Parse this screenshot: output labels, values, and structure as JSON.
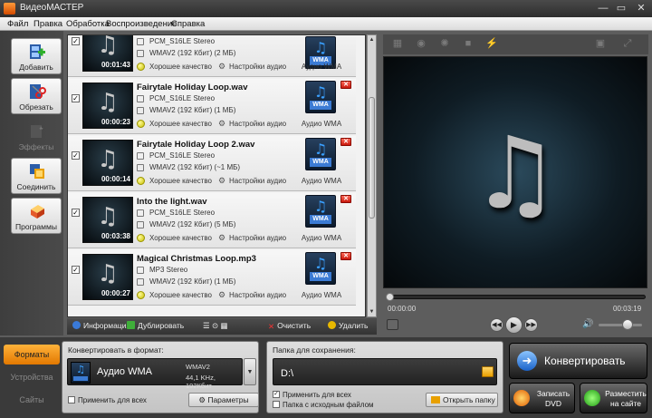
{
  "window": {
    "title": "ВидеоМАСТЕР",
    "controls": [
      "—",
      "▭",
      "✕"
    ]
  },
  "menu": [
    "Файл",
    "Правка",
    "Обработка",
    "Воспроизведение",
    "Справка"
  ],
  "tools": [
    {
      "label": "Добавить",
      "icon": "film-add-icon",
      "enabled": true
    },
    {
      "label": "Обрезать",
      "icon": "scissors-icon",
      "enabled": true
    },
    {
      "label": "Эффекты",
      "icon": "magic-wand-icon",
      "enabled": false
    },
    {
      "label": "Соединить",
      "icon": "join-film-icon",
      "enabled": true
    },
    {
      "label": "Программы",
      "icon": "software-box-icon",
      "enabled": true
    }
  ],
  "files": [
    {
      "name": "",
      "codec": "PCM_S16LE Stereo",
      "output": "WMAV2 (192 Кбит) (2 МБ)",
      "duration": "00:01:43",
      "quality": "Хорошее качество",
      "settings": "Настройки аудио",
      "format": "Аудио WMA",
      "badge": "WMA",
      "checked": true
    },
    {
      "name": "Fairytale Holiday Loop.wav",
      "codec": "PCM_S16LE Stereo",
      "output": "WMAV2 (192 Кбит) (1 МБ)",
      "duration": "00:00:23",
      "quality": "Хорошее качество",
      "settings": "Настройки аудио",
      "format": "Аудио WMA",
      "badge": "WMA",
      "checked": true
    },
    {
      "name": "Fairytale Holiday Loop 2.wav",
      "codec": "PCM_S16LE Stereo",
      "output": "WMAV2 (192 Кбит) (~1 МБ)",
      "duration": "00:00:14",
      "quality": "Хорошее качество",
      "settings": "Настройки аудио",
      "format": "Аудио WMA",
      "badge": "WMA",
      "checked": true
    },
    {
      "name": "Into the light.wav",
      "codec": "PCM_S16LE Stereo",
      "output": "WMAV2 (192 Кбит) (5 МБ)",
      "duration": "00:03:38",
      "quality": "Хорошее качество",
      "settings": "Настройки аудио",
      "format": "Аудио WMA",
      "badge": "WMA",
      "checked": true
    },
    {
      "name": "Magical Christmas Loop.mp3",
      "codec": "MP3 Stereo",
      "output": "WMAV2 (192 Кбит) (1 МБ)",
      "duration": "00:00:27",
      "quality": "Хорошее качество",
      "settings": "Настройки аудио",
      "format": "Аудио WMA",
      "badge": "WMA",
      "checked": true
    }
  ],
  "list_actions": {
    "info": "Информация",
    "duplicate": "Дублировать",
    "clear": "Очистить",
    "delete": "Удалить"
  },
  "player": {
    "current_time": "00:00:00",
    "total_time": "00:03:19",
    "volume": 0.65,
    "progress": 0
  },
  "bottom_tabs": [
    {
      "label": "Форматы",
      "active": true
    },
    {
      "label": "Устройства",
      "active": false
    },
    {
      "label": "Сайты",
      "active": false
    }
  ],
  "convert_panel": {
    "title": "Конвертировать в формат:",
    "format_name": "Аудио WMA",
    "codec": "WMAV2",
    "params": "44,1 KHz,  192Кбит",
    "apply_all": "Применить для всех",
    "params_button": "Параметры"
  },
  "save_panel": {
    "title": "Папка для сохранения:",
    "path": "D:\\",
    "apply_all": "Применить для всех",
    "source_folder": "Папка с исходным файлом",
    "open_folder": "Открыть папку"
  },
  "actions": {
    "convert": "Конвертировать",
    "burn_line1": "Записать",
    "burn_line2": "DVD",
    "publish_line1": "Разместить",
    "publish_line2": "на сайте"
  },
  "colors": {
    "accent": "#f08a00",
    "convert_arrow": "#1a62c8",
    "wma_badge": "#3b7bd4",
    "delete_red": "#c8180c"
  }
}
